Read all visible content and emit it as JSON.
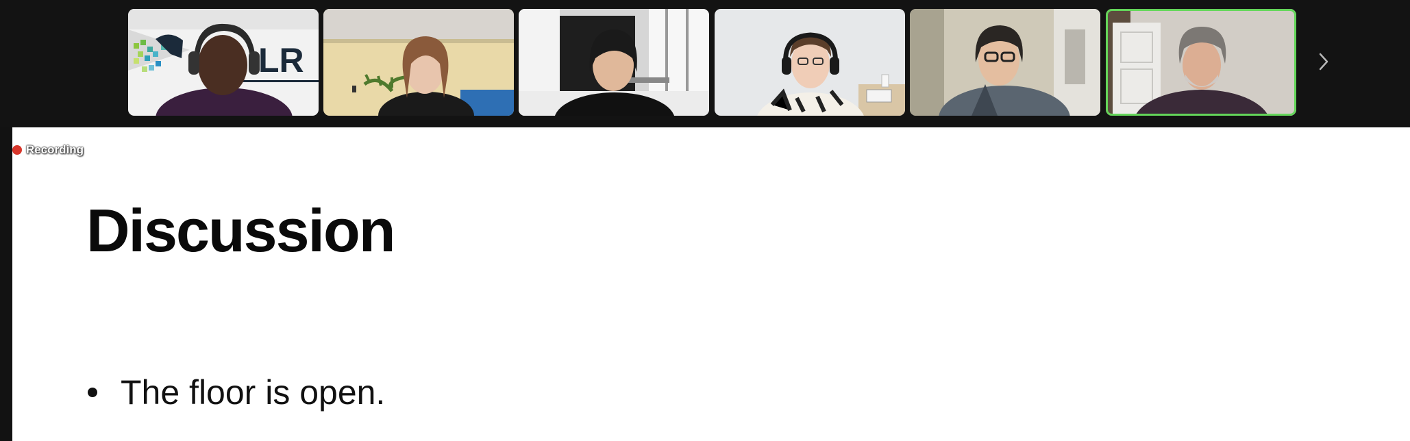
{
  "app": {
    "recording_label": "Recording",
    "colors": {
      "active_speaker_border": "#64d65a",
      "recording_dot": "#d8362b",
      "background": "#121212"
    }
  },
  "participants": [
    {
      "id": "p1",
      "logo_text": "LR",
      "active": false
    },
    {
      "id": "p2",
      "active": false
    },
    {
      "id": "p3",
      "active": false
    },
    {
      "id": "p4",
      "active": false
    },
    {
      "id": "p5",
      "active": false
    },
    {
      "id": "p6",
      "active": true
    }
  ],
  "gallery_nav": {
    "next_icon": "chevron-right-icon"
  },
  "slide": {
    "title": "Discussion",
    "bullets": [
      "The floor is open."
    ]
  }
}
